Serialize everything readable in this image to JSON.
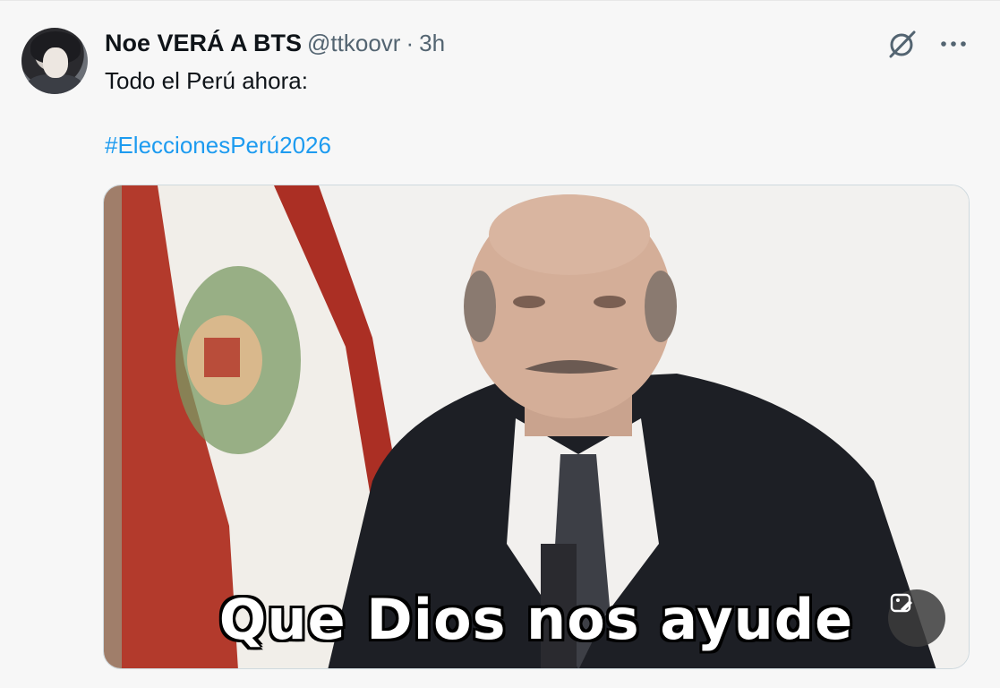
{
  "tweet": {
    "author_name": "Noe VERÁ A BTS",
    "handle": "@ttkoovr",
    "separator": "·",
    "time": "3h",
    "text": "Todo el Perú ahora:",
    "hashtag": "#EleccionesPerú2026",
    "media": {
      "caption": "Que Dios nos ayude",
      "type": "gif"
    }
  },
  "icons": {
    "grok": "slash-circle-icon",
    "more": "more-horizontal-icon",
    "alt": "image-edit-icon"
  },
  "colors": {
    "link": "#1d9bf0",
    "secondary_text": "#536471",
    "primary_text": "#0f1419"
  }
}
